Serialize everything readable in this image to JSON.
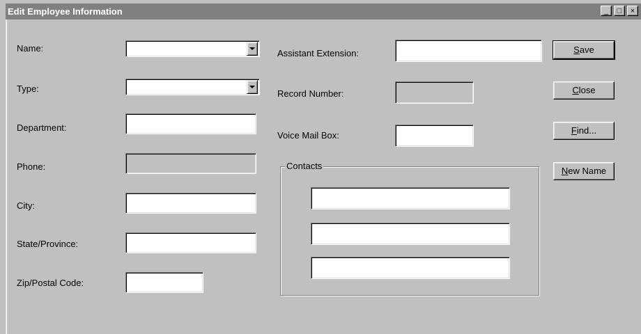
{
  "window": {
    "title": "Edit Employee Information",
    "controls": {
      "minimize": "_",
      "maximize": "□",
      "close": "×"
    }
  },
  "form": {
    "name": {
      "label": "Name:",
      "value": ""
    },
    "type": {
      "label": "Type:",
      "value": ""
    },
    "department": {
      "label": "Department:",
      "value": ""
    },
    "phone": {
      "label": "Phone:",
      "value": ""
    },
    "city": {
      "label": "City:",
      "value": ""
    },
    "state": {
      "label": "State/Province:",
      "value": ""
    },
    "zip": {
      "label": "Zip/Postal Code:",
      "value": ""
    },
    "assistant_extension": {
      "label": "Assistant Extension:",
      "value": ""
    },
    "record_number": {
      "label": "Record Number:",
      "value": ""
    },
    "voice_mail_box": {
      "label": "Voice Mail Box:",
      "value": ""
    },
    "contacts": {
      "label": "Contacts",
      "values": [
        "",
        "",
        ""
      ]
    }
  },
  "buttons": {
    "save": {
      "accel": "S",
      "rest": "ave"
    },
    "close": {
      "accel": "C",
      "rest": "lose"
    },
    "find": {
      "accel": "F",
      "rest": "ind..."
    },
    "new_name": {
      "accel": "N",
      "rest": "ew Name"
    }
  }
}
